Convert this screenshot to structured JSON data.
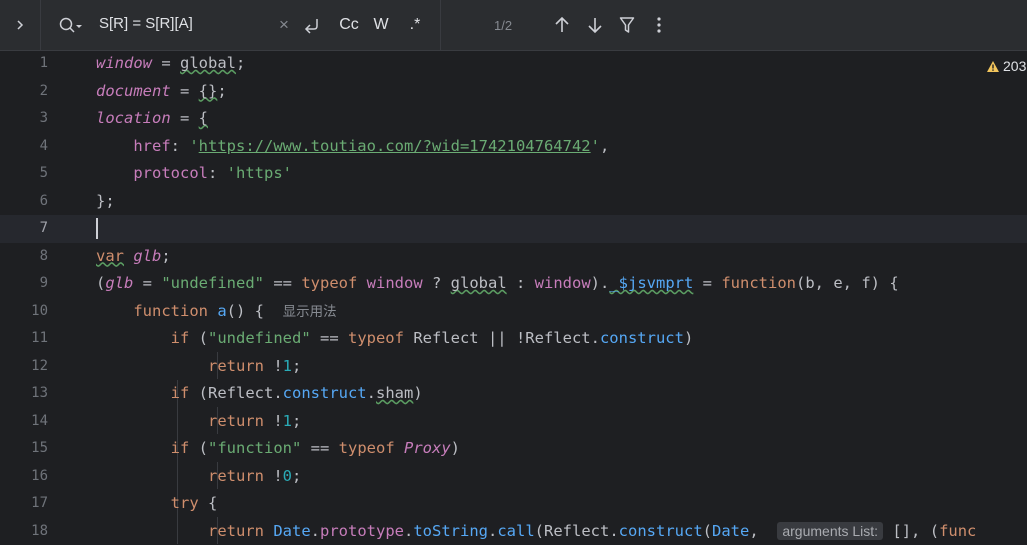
{
  "find": {
    "query": "S[R] = S[R][A]",
    "clear_symbol": "×",
    "case_label": "Cc",
    "words_label": "W",
    "regex_label": ".*",
    "matches": "1/2"
  },
  "editor": {
    "warning_count": "203",
    "param_hint": "arguments List:",
    "usage_hint": "显示用法"
  },
  "lines": [
    {
      "n": "1"
    },
    {
      "n": "2"
    },
    {
      "n": "3"
    },
    {
      "n": "4"
    },
    {
      "n": "5"
    },
    {
      "n": "6"
    },
    {
      "n": "7"
    },
    {
      "n": "8"
    },
    {
      "n": "9"
    },
    {
      "n": "10"
    },
    {
      "n": "11"
    },
    {
      "n": "12"
    },
    {
      "n": "13"
    },
    {
      "n": "14"
    },
    {
      "n": "15"
    },
    {
      "n": "16"
    },
    {
      "n": "17"
    },
    {
      "n": "18"
    }
  ],
  "colors": {
    "background": "#1e1f22",
    "keyword": "#cf8e6d",
    "string": "#6aab73",
    "global_var": "#c77dbb",
    "method": "#56a8f5",
    "number": "#2aacb8",
    "accent": "#3574f0"
  }
}
